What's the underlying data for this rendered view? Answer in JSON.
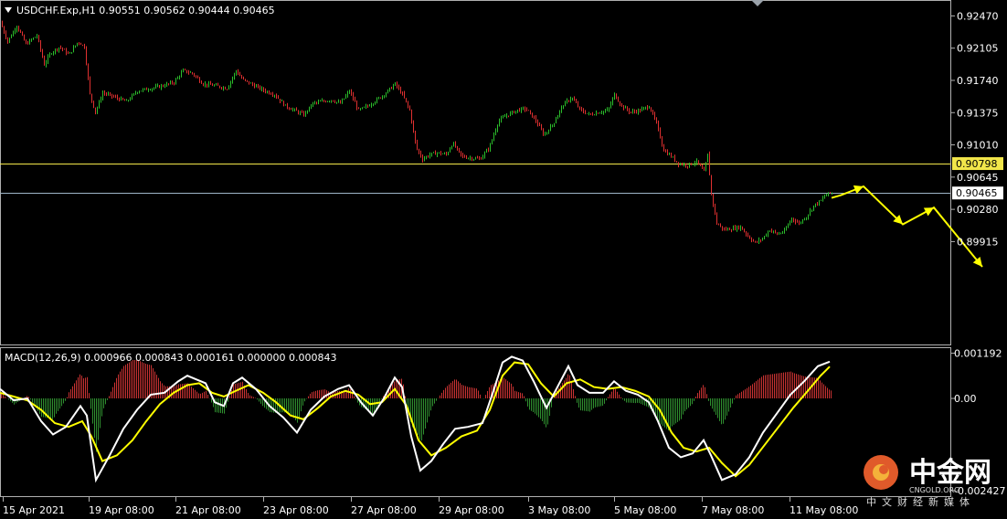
{
  "chart_data": [
    {
      "type": "candlestick",
      "symbol_line": "USDCHF.Exp,H1  0.90551 0.90562 0.90444 0.90465",
      "ylim": [
        0.8874,
        0.9265
      ],
      "y_ticks": [
        "0.92470",
        "0.92105",
        "0.91740",
        "0.91375",
        "0.91010",
        "0.90645",
        "0.90280",
        "0.89915"
      ],
      "hlines": [
        {
          "value": 0.90798,
          "label": "0.90798",
          "color": "#f2e64a"
        },
        {
          "value": 0.90465,
          "label": "0.90465",
          "color": "#9fb5c8"
        }
      ],
      "colors": {
        "up": "#2bbf2b",
        "down": "#e03030",
        "arrow": "#ffff00"
      },
      "price_path": [
        [
          0,
          0.924
        ],
        [
          8,
          0.9218
        ],
        [
          18,
          0.9236
        ],
        [
          28,
          0.9215
        ],
        [
          40,
          0.9225
        ],
        [
          48,
          0.9192
        ],
        [
          55,
          0.9205
        ],
        [
          65,
          0.9212
        ],
        [
          75,
          0.9203
        ],
        [
          85,
          0.9218
        ],
        [
          92,
          0.9212
        ],
        [
          98,
          0.9158
        ],
        [
          104,
          0.9138
        ],
        [
          112,
          0.916
        ],
        [
          125,
          0.9155
        ],
        [
          138,
          0.915
        ],
        [
          150,
          0.9162
        ],
        [
          165,
          0.9165
        ],
        [
          178,
          0.9168
        ],
        [
          190,
          0.9172
        ],
        [
          200,
          0.9185
        ],
        [
          210,
          0.9182
        ],
        [
          222,
          0.917
        ],
        [
          235,
          0.9168
        ],
        [
          248,
          0.9165
        ],
        [
          258,
          0.9185
        ],
        [
          265,
          0.9175
        ],
        [
          278,
          0.9168
        ],
        [
          290,
          0.9162
        ],
        [
          300,
          0.9158
        ],
        [
          312,
          0.9145
        ],
        [
          322,
          0.914
        ],
        [
          332,
          0.9135
        ],
        [
          342,
          0.9148
        ],
        [
          352,
          0.915
        ],
        [
          362,
          0.9152
        ],
        [
          372,
          0.9148
        ],
        [
          382,
          0.9162
        ],
        [
          392,
          0.914
        ],
        [
          402,
          0.9145
        ],
        [
          412,
          0.9152
        ],
        [
          422,
          0.916
        ],
        [
          432,
          0.917
        ],
        [
          440,
          0.9158
        ],
        [
          448,
          0.914
        ],
        [
          455,
          0.9098
        ],
        [
          462,
          0.9085
        ],
        [
          470,
          0.909
        ],
        [
          478,
          0.9092
        ],
        [
          488,
          0.909
        ],
        [
          495,
          0.9103
        ],
        [
          505,
          0.9088
        ],
        [
          515,
          0.9086
        ],
        [
          525,
          0.9085
        ],
        [
          535,
          0.9098
        ],
        [
          545,
          0.9128
        ],
        [
          555,
          0.9135
        ],
        [
          565,
          0.914
        ],
        [
          575,
          0.9142
        ],
        [
          585,
          0.913
        ],
        [
          595,
          0.9112
        ],
        [
          605,
          0.9125
        ],
        [
          615,
          0.9145
        ],
        [
          625,
          0.9155
        ],
        [
          635,
          0.914
        ],
        [
          645,
          0.9135
        ],
        [
          655,
          0.9138
        ],
        [
          665,
          0.914
        ],
        [
          672,
          0.9158
        ],
        [
          680,
          0.9145
        ],
        [
          690,
          0.9138
        ],
        [
          700,
          0.914
        ],
        [
          710,
          0.9145
        ],
        [
          718,
          0.9125
        ],
        [
          726,
          0.9095
        ],
        [
          734,
          0.9088
        ],
        [
          742,
          0.908
        ],
        [
          752,
          0.9078
        ],
        [
          762,
          0.9082
        ],
        [
          770,
          0.907
        ],
        [
          774,
          0.909
        ],
        [
          778,
          0.9045
        ],
        [
          784,
          0.9012
        ],
        [
          792,
          0.9005
        ],
        [
          800,
          0.9006
        ],
        [
          810,
          0.9008
        ],
        [
          818,
          0.8998
        ],
        [
          826,
          0.899
        ],
        [
          834,
          0.8995
        ],
        [
          842,
          0.9005
        ],
        [
          850,
          0.9
        ],
        [
          858,
          0.9003
        ],
        [
          866,
          0.9018
        ],
        [
          874,
          0.9012
        ],
        [
          882,
          0.902
        ],
        [
          890,
          0.9032
        ],
        [
          898,
          0.9038
        ],
        [
          904,
          0.9045
        ],
        [
          910,
          0.9047
        ]
      ],
      "projection": [
        [
          910,
          0.9041
        ],
        [
          920,
          0.9044
        ],
        [
          945,
          0.9054
        ],
        [
          988,
          0.9011
        ],
        [
          1022,
          0.903
        ],
        [
          1075,
          0.8963
        ]
      ],
      "x_labels": [
        "15 Apr 2021",
        "19 Apr 08:00",
        "21 Apr 08:00",
        "23 Apr 08:00",
        "27 Apr 08:00",
        "29 Apr 08:00",
        "3 May 08:00",
        "5 May 08:00",
        "7 May 08:00",
        "11 May 08:00"
      ]
    },
    {
      "type": "macd",
      "title": "MACD(12,26,9) 0.000966 0.000843 0.000161 0.000000 0.000843",
      "ylim": [
        -0.0026,
        0.00135
      ],
      "y_ticks": [
        "0.001192",
        "0.00",
        "-0.002427"
      ],
      "colors": {
        "macd": "#ffffff",
        "signal": "#ffff00",
        "hist_pos": "#c83232",
        "hist_neg": "#2f8f2f"
      },
      "macd": [
        [
          0,
          0.00025
        ],
        [
          15,
          -5e-05
        ],
        [
          30,
          0.0
        ],
        [
          45,
          -0.0006
        ],
        [
          58,
          -0.00095
        ],
        [
          72,
          -0.00075
        ],
        [
          88,
          -0.0002
        ],
        [
          95,
          -0.00045
        ],
        [
          105,
          -0.00215
        ],
        [
          120,
          -0.0015
        ],
        [
          135,
          -0.0008
        ],
        [
          150,
          -0.0003
        ],
        [
          165,
          0.0001
        ],
        [
          180,
          0.00015
        ],
        [
          195,
          0.00045
        ],
        [
          205,
          0.0006
        ],
        [
          215,
          0.0005
        ],
        [
          225,
          0.0004
        ],
        [
          235,
          -0.0001
        ],
        [
          245,
          -0.0002
        ],
        [
          255,
          0.0004
        ],
        [
          265,
          0.00055
        ],
        [
          280,
          0.00025
        ],
        [
          295,
          -0.0002
        ],
        [
          310,
          -0.0005
        ],
        [
          325,
          -0.0009
        ],
        [
          340,
          -0.0003
        ],
        [
          355,
          5e-05
        ],
        [
          370,
          0.00025
        ],
        [
          382,
          0.00035
        ],
        [
          395,
          -0.0001
        ],
        [
          408,
          -0.00045
        ],
        [
          420,
          0.0
        ],
        [
          432,
          0.00055
        ],
        [
          440,
          0.0003
        ],
        [
          450,
          -0.001
        ],
        [
          460,
          -0.0019
        ],
        [
          472,
          -0.00165
        ],
        [
          485,
          -0.0012
        ],
        [
          498,
          -0.0008
        ],
        [
          512,
          -0.00075
        ],
        [
          528,
          -0.00065
        ],
        [
          540,
          0.0002
        ],
        [
          550,
          0.00095
        ],
        [
          560,
          0.0011
        ],
        [
          572,
          0.001
        ],
        [
          584,
          0.00045
        ],
        [
          598,
          -0.00025
        ],
        [
          610,
          0.0003
        ],
        [
          622,
          0.00085
        ],
        [
          632,
          0.00035
        ],
        [
          645,
          0.00015
        ],
        [
          660,
          0.00015
        ],
        [
          672,
          0.00045
        ],
        [
          685,
          0.0002
        ],
        [
          698,
          0.0001
        ],
        [
          710,
          -0.0001
        ],
        [
          720,
          -0.0006
        ],
        [
          732,
          -0.0013
        ],
        [
          745,
          -0.00155
        ],
        [
          758,
          -0.00145
        ],
        [
          770,
          -0.0011
        ],
        [
          778,
          -0.0015
        ],
        [
          790,
          -0.00215
        ],
        [
          805,
          -0.002
        ],
        [
          820,
          -0.00155
        ],
        [
          835,
          -0.0009
        ],
        [
          850,
          -0.0004
        ],
        [
          865,
          0.0001
        ],
        [
          880,
          0.00045
        ],
        [
          895,
          0.00085
        ],
        [
          908,
          0.00097
        ]
      ],
      "signal": [
        [
          0,
          0.00015
        ],
        [
          15,
          5e-05
        ],
        [
          30,
          -5e-05
        ],
        [
          45,
          -0.0003
        ],
        [
          60,
          -0.00065
        ],
        [
          75,
          -0.00075
        ],
        [
          90,
          -0.0006
        ],
        [
          100,
          -0.001
        ],
        [
          112,
          -0.00165
        ],
        [
          128,
          -0.0015
        ],
        [
          145,
          -0.0011
        ],
        [
          160,
          -0.0006
        ],
        [
          175,
          -0.00015
        ],
        [
          190,
          0.00015
        ],
        [
          205,
          0.00035
        ],
        [
          218,
          0.0004
        ],
        [
          232,
          0.00015
        ],
        [
          245,
          5e-05
        ],
        [
          258,
          0.0002
        ],
        [
          272,
          0.00035
        ],
        [
          288,
          0.00015
        ],
        [
          302,
          -0.0001
        ],
        [
          318,
          -0.00045
        ],
        [
          332,
          -0.00055
        ],
        [
          348,
          -0.00025
        ],
        [
          362,
          5e-05
        ],
        [
          378,
          0.0002
        ],
        [
          392,
          0.0001
        ],
        [
          405,
          -0.00015
        ],
        [
          418,
          -0.0001
        ],
        [
          432,
          0.00025
        ],
        [
          445,
          -0.0002
        ],
        [
          458,
          -0.0011
        ],
        [
          472,
          -0.0015
        ],
        [
          488,
          -0.0013
        ],
        [
          505,
          -0.001
        ],
        [
          522,
          -0.00085
        ],
        [
          536,
          -0.0003
        ],
        [
          550,
          0.0006
        ],
        [
          563,
          0.00095
        ],
        [
          578,
          0.0009
        ],
        [
          592,
          0.0004
        ],
        [
          606,
          5e-05
        ],
        [
          620,
          0.0004
        ],
        [
          635,
          0.0005
        ],
        [
          650,
          0.0003
        ],
        [
          665,
          0.00025
        ],
        [
          680,
          0.0003
        ],
        [
          695,
          0.0002
        ],
        [
          710,
          5e-05
        ],
        [
          722,
          -0.0003
        ],
        [
          735,
          -0.0009
        ],
        [
          748,
          -0.0013
        ],
        [
          762,
          -0.0014
        ],
        [
          776,
          -0.0013
        ],
        [
          790,
          -0.0017
        ],
        [
          805,
          -0.00205
        ],
        [
          820,
          -0.00175
        ],
        [
          836,
          -0.00125
        ],
        [
          852,
          -0.00075
        ],
        [
          868,
          -0.00025
        ],
        [
          884,
          0.0002
        ],
        [
          898,
          0.0006
        ],
        [
          908,
          0.00084
        ]
      ]
    }
  ],
  "watermark": {
    "name": "中金网",
    "domain": "CNGOLD.ORG",
    "tagline": "中文财经新媒体"
  }
}
